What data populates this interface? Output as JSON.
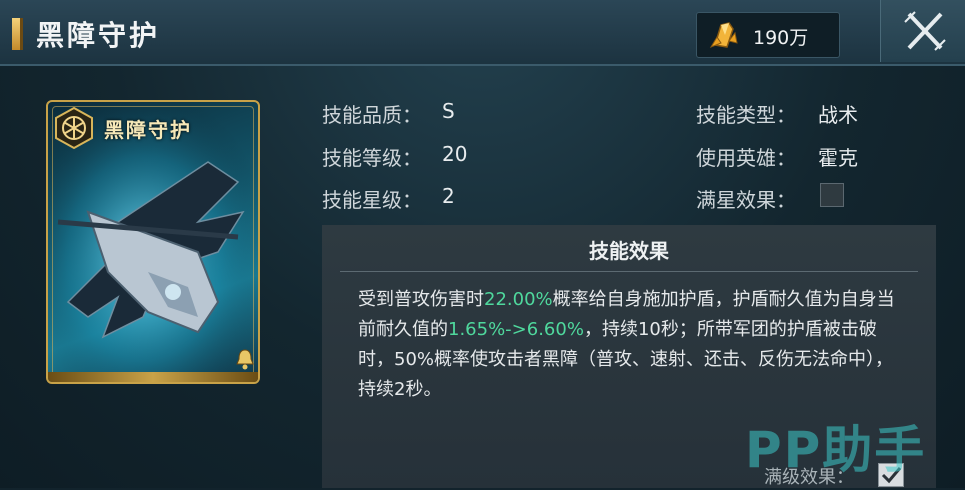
{
  "header": {
    "title": "黑障守护",
    "currency_value": "190万",
    "currency_icon": "gold-crystal-icon",
    "close_icon": "close-x-icon"
  },
  "card": {
    "title": "黑障守护",
    "emblem_icon": "hexagon-aperture-icon",
    "bell_icon": "bell-icon"
  },
  "info": {
    "quality_label": "技能品质：",
    "quality_value": "S",
    "level_label": "技能等级：",
    "level_value": "20",
    "star_label": "技能星级：",
    "star_value": "2",
    "type_label": "技能类型：",
    "type_value": "战术",
    "hero_label": "使用英雄：",
    "hero_value": "霍克",
    "full_star_label": "满星效果：",
    "full_star_checked": false
  },
  "effect": {
    "title": "技能效果",
    "text_part1": "受到普攻伤害时",
    "text_hl1": "22.00%",
    "text_part2": "概率给自身施加护盾，护盾耐久值为自身当前耐久值的",
    "text_hl2": "1.65%->6.60%",
    "text_part3": "，持续10秒；所带军团的护盾被击破时，50%概率使攻击者黑障（普攻、速射、还击、反伤无法命中），持续2秒。",
    "max_level_label": "满级效果：",
    "max_level_checked": true
  },
  "watermark": "PP助手",
  "colors": {
    "highlight": "#4fd89d",
    "card_border": "#c8a248"
  }
}
